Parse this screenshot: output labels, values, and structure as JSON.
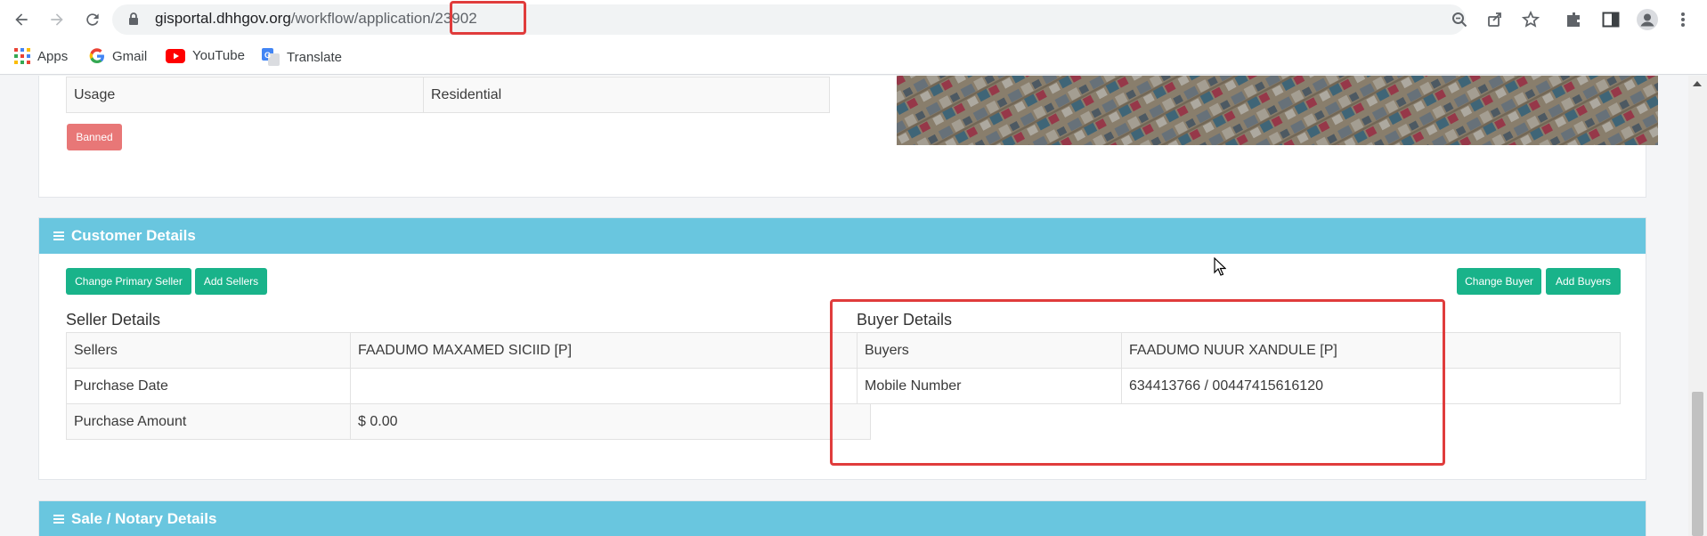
{
  "browser": {
    "url_host": "gisportal.dhhgov.org",
    "url_path": "/workflow/application/23902",
    "bookmarks": [
      {
        "label": "Apps",
        "icon": "apps-grid-icon"
      },
      {
        "label": "Gmail",
        "icon": "google-icon"
      },
      {
        "label": "YouTube",
        "icon": "youtube-icon"
      },
      {
        "label": "Translate",
        "icon": "translate-icon"
      }
    ]
  },
  "property": {
    "usage_label": "Usage",
    "usage_value": "Residential",
    "status_badge": "Banned"
  },
  "customer": {
    "header": "Customer Details",
    "buttons": {
      "change_primary_seller": "Change Primary Seller",
      "add_sellers": "Add Sellers",
      "change_buyer": "Change Buyer",
      "add_buyers": "Add Buyers"
    },
    "seller_title": "Seller Details",
    "seller_rows": [
      {
        "label": "Sellers",
        "value": "FAADUMO MAXAMED SICIID [P]"
      },
      {
        "label": "Purchase Date",
        "value": ""
      },
      {
        "label": "Purchase Amount",
        "value": "$ 0.00"
      }
    ],
    "buyer_title": "Buyer Details",
    "buyer_rows": [
      {
        "label": "Buyers",
        "value": "FAADUMO NUUR XANDULE [P]"
      },
      {
        "label": "Mobile Number",
        "value": "634413766 / 00447415616120"
      }
    ]
  },
  "sale": {
    "header": "Sale / Notary Details"
  },
  "colors": {
    "accent_header": "#69c6df",
    "button_green": "#19b38a",
    "badge_red": "#e87777",
    "highlight_red": "#e03c3c"
  }
}
